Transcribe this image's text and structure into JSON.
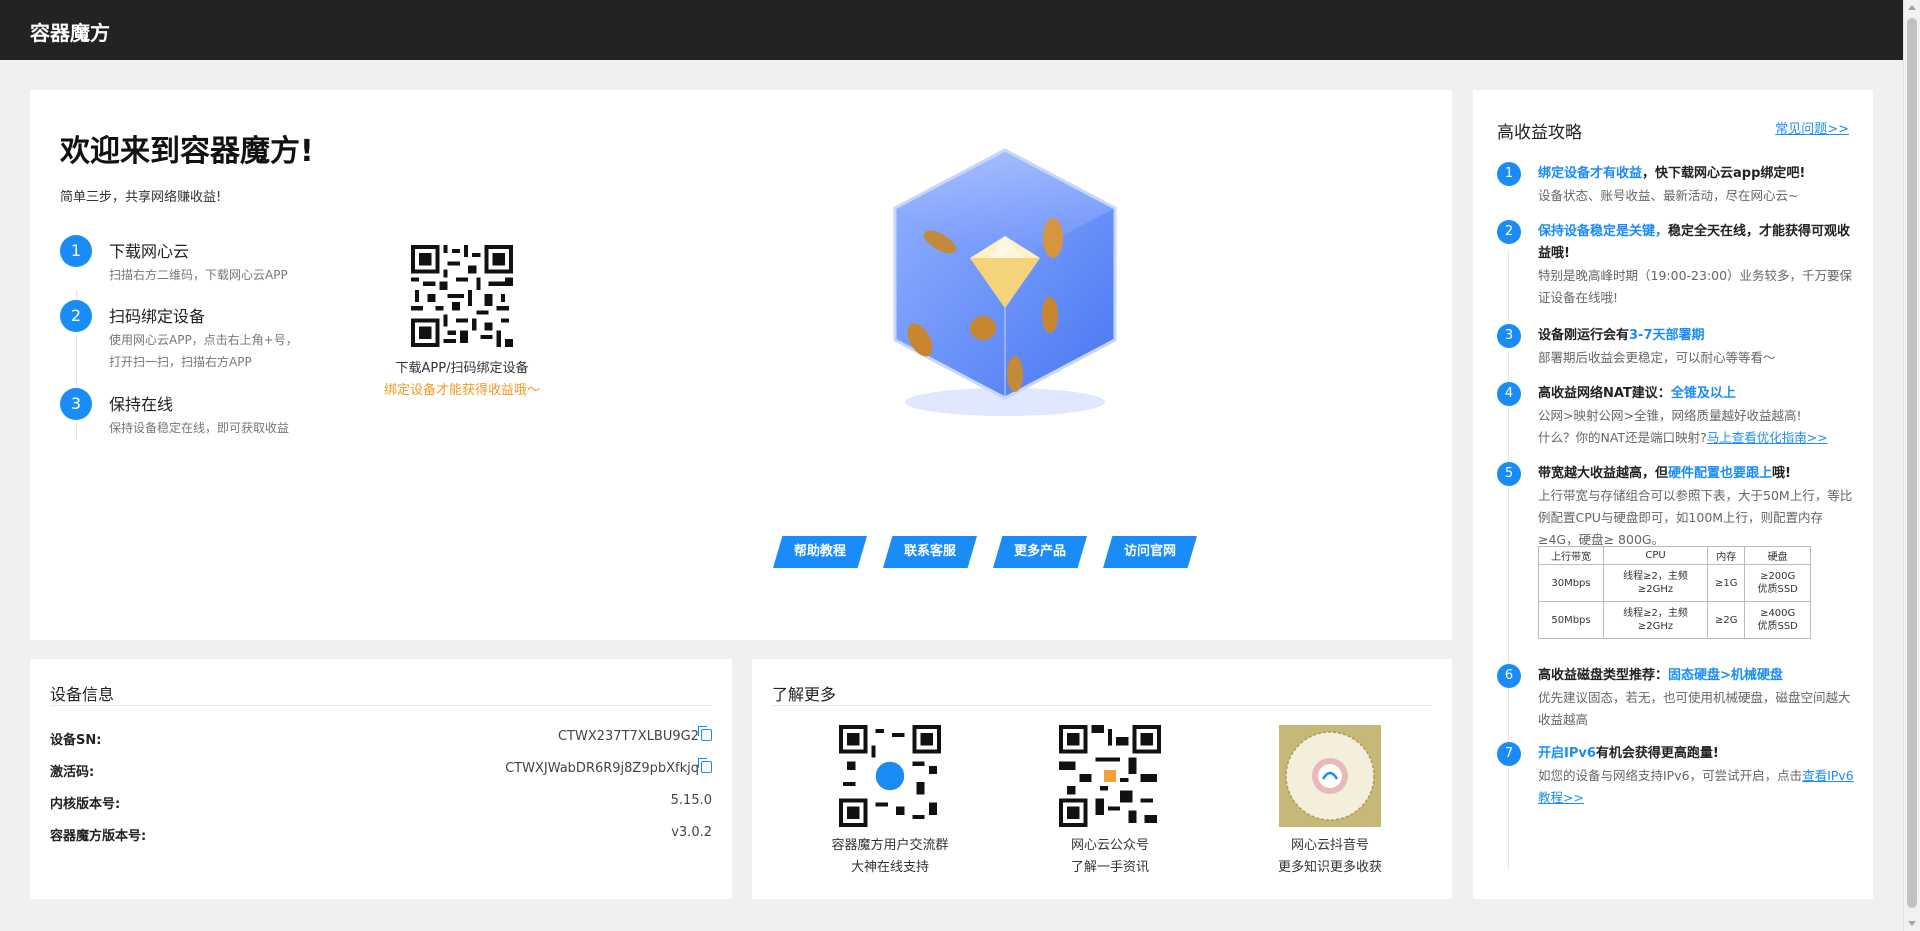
{
  "header": {
    "title": "容器魔方"
  },
  "hero": {
    "title": "欢迎来到容器魔方!",
    "subtitle": "简单三步，共享网络赚收益!",
    "steps": [
      {
        "num": "1",
        "title": "下载网心云",
        "desc1": "扫描右方二维码，下载网心云APP",
        "desc2": ""
      },
      {
        "num": "2",
        "title": "扫码绑定设备",
        "desc1": "使用网心云APP，点击右上角+号，",
        "desc2": "打开扫一扫，扫描右方APP"
      },
      {
        "num": "3",
        "title": "保持在线",
        "desc1": "保持设备稳定在线，即可获取收益",
        "desc2": ""
      }
    ],
    "qr_caption": "下载APP/扫码绑定设备",
    "qr_note": "绑定设备才能获得收益哦～",
    "buttons": [
      "帮助教程",
      "联系客服",
      "更多产品",
      "访问官网"
    ]
  },
  "tips": {
    "title": "高收益攻略",
    "faq_link": "常见问题>>",
    "items": [
      {
        "num": "1",
        "t_hl": "绑定设备才有收益",
        "t_rest": "，快下载网心云app绑定吧!",
        "desc": "设备状态、账号收益、最新活动，尽在网心云~"
      },
      {
        "num": "2",
        "t_hl": "保持设备稳定是关键，",
        "t_rest": "稳定全天在线，才能获得可观收益哦!",
        "desc": "特别是晚高峰时期（19:00-23:00）业务较多，千万要保证设备在线哦!"
      },
      {
        "num": "3",
        "t_pre": "设备刚运行会有",
        "t_hl": "3-7天部署期",
        "desc": "部署期后收益会更稳定，可以耐心等等看～"
      },
      {
        "num": "4",
        "t_pre": "高收益网络NAT建议：",
        "t_hl": "全锥及以上",
        "desc": "公网>映射公网>全锥，网络质量越好收益越高!",
        "desc2": "什么？你的NAT还是端口映射?",
        "link": "马上查看优化指南>>"
      },
      {
        "num": "5",
        "t_pre": "带宽越大收益越高，但",
        "t_hl": "硬件配置也要跟上",
        "t_rest": "哦!",
        "desc": "上行带宽与存储组合可以参照下表，大于50M上行，等比例配置CPU与硬盘即可，如100M上行，则配置内存≥4G，硬盘≥ 800G。"
      },
      {
        "num": "6",
        "t_pre": "高收益磁盘类型推荐：",
        "t_hl": "固态硬盘>机械硬盘",
        "desc": "优先建议固态，若无，也可使用机械硬盘，磁盘空间越大收益越高"
      },
      {
        "num": "7",
        "t_hl": "开启IPv6",
        "t_rest": "有机会获得更高跑量!",
        "desc": "如您的设备与网络支持IPv6，可尝试开启，点击",
        "link": "查看IPv6教程>>"
      }
    ],
    "table": {
      "headers": [
        "上行带宽",
        "CPU",
        "内存",
        "硬盘"
      ],
      "rows": [
        {
          "bw": "30Mbps",
          "cpu1": "线程≥2，主频",
          "cpu2": "≥2GHz",
          "mem": "≥1G",
          "disk1": "≥200G",
          "disk2": "优质SSD"
        },
        {
          "bw": "50Mbps",
          "cpu1": "线程≥2，主频",
          "cpu2": "≥2GHz",
          "mem": "≥2G",
          "disk1": "≥400G",
          "disk2": "优质SSD"
        }
      ]
    }
  },
  "device": {
    "title": "设备信息",
    "rows": [
      {
        "label": "设备SN:",
        "value": "CTWX237T7XLBU9G2"
      },
      {
        "label": "激活码:",
        "value": "CTWXJWabDR6R9j8Z9pbXfkjq"
      },
      {
        "label": "内核版本号:",
        "value": "5.15.0"
      },
      {
        "label": "容器魔方版本号:",
        "value": "v3.0.2"
      }
    ]
  },
  "learn": {
    "title": "了解更多",
    "items": [
      {
        "c1": "容器魔方用户交流群",
        "c2": "大神在线支持"
      },
      {
        "c1": "网心云公众号",
        "c2": "了解一手资讯"
      },
      {
        "c1": "网心云抖音号",
        "c2": "更多知识更多收获"
      }
    ]
  },
  "colors": {
    "accent": "#1a8cf8",
    "warning": "#f59a23",
    "header_bg": "#232323",
    "page_bg": "#f0f0f0"
  }
}
